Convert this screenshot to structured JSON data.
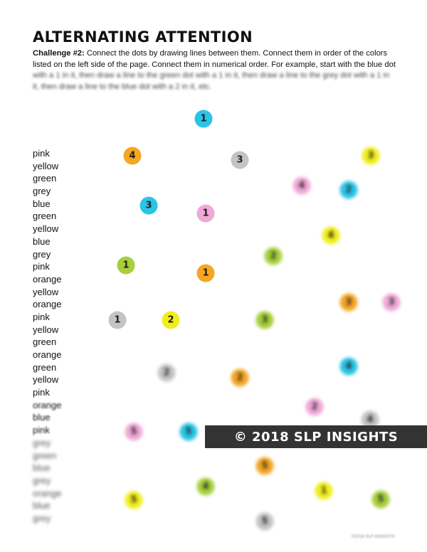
{
  "title": "ALTERNATING ATTENTION",
  "instructions": {
    "label": "Challenge #2:",
    "text_visible": " Connect the dots by drawing lines between them. Connect them in order of the colors listed on the left side of the page. Connect them in numerical order. For example, start with the blue dot",
    "text_blurred": " with a 1 in it, then draw a line to the green dot with a 1 in it, then draw a line to the grey dot with a 1 in it, then draw a line to the blue dot with a 2 in it, etc."
  },
  "color_list": [
    "pink",
    "yellow",
    "green",
    "grey",
    "blue",
    "green",
    "yellow",
    "blue",
    "grey",
    "pink",
    "orange",
    "yellow",
    "orange",
    "pink",
    "yellow",
    "green",
    "orange",
    "green",
    "yellow",
    "pink",
    "orange",
    "blue",
    "pink",
    "grey",
    "green",
    "blue",
    "grey",
    "orange",
    "blue",
    "grey"
  ],
  "dot_colors": {
    "blue": "#29c4e6",
    "orange": "#f5a623",
    "grey": "#c4c4c4",
    "yellow": "#f2ee1c",
    "pink": "#f0a8d8",
    "green": "#a6cf3a"
  },
  "dots": [
    {
      "color": "blue",
      "number": "1",
      "blurred": false
    },
    {
      "color": "orange",
      "number": "4",
      "blurred": false
    },
    {
      "color": "grey",
      "number": "3",
      "blurred": false
    },
    {
      "color": "yellow",
      "number": "3",
      "blurred": true
    },
    {
      "color": "pink",
      "number": "4",
      "blurred": true
    },
    {
      "color": "blue",
      "number": "2",
      "blurred": true
    },
    {
      "color": "blue",
      "number": "3",
      "blurred": false
    },
    {
      "color": "pink",
      "number": "1",
      "blurred": false
    },
    {
      "color": "yellow",
      "number": "4",
      "blurred": true
    },
    {
      "color": "green",
      "number": "2",
      "blurred": true
    },
    {
      "color": "green",
      "number": "1",
      "blurred": false
    },
    {
      "color": "orange",
      "number": "1",
      "blurred": false
    },
    {
      "color": "orange",
      "number": "3",
      "blurred": true
    },
    {
      "color": "pink",
      "number": "3",
      "blurred": true
    },
    {
      "color": "grey",
      "number": "1",
      "blurred": false
    },
    {
      "color": "yellow",
      "number": "2",
      "blurred": false
    },
    {
      "color": "green",
      "number": "3",
      "blurred": true
    },
    {
      "color": "blue",
      "number": "4",
      "blurred": true
    },
    {
      "color": "grey",
      "number": "2",
      "blurred": true
    },
    {
      "color": "orange",
      "number": "2",
      "blurred": true
    },
    {
      "color": "pink",
      "number": "2",
      "blurred": true
    },
    {
      "color": "grey",
      "number": "4",
      "blurred": true
    },
    {
      "color": "pink",
      "number": "5",
      "blurred": true
    },
    {
      "color": "blue",
      "number": "5",
      "blurred": true
    },
    {
      "color": "orange",
      "number": "5",
      "blurred": true
    },
    {
      "color": "green",
      "number": "4",
      "blurred": true
    },
    {
      "color": "yellow",
      "number": "1",
      "blurred": true
    },
    {
      "color": "green",
      "number": "5",
      "blurred": true
    },
    {
      "color": "yellow",
      "number": "5",
      "blurred": true
    },
    {
      "color": "grey",
      "number": "5",
      "blurred": true
    }
  ],
  "watermark": "© 2018 SLP INSIGHTS",
  "footer": "©2018 SLP INSIGHTS"
}
